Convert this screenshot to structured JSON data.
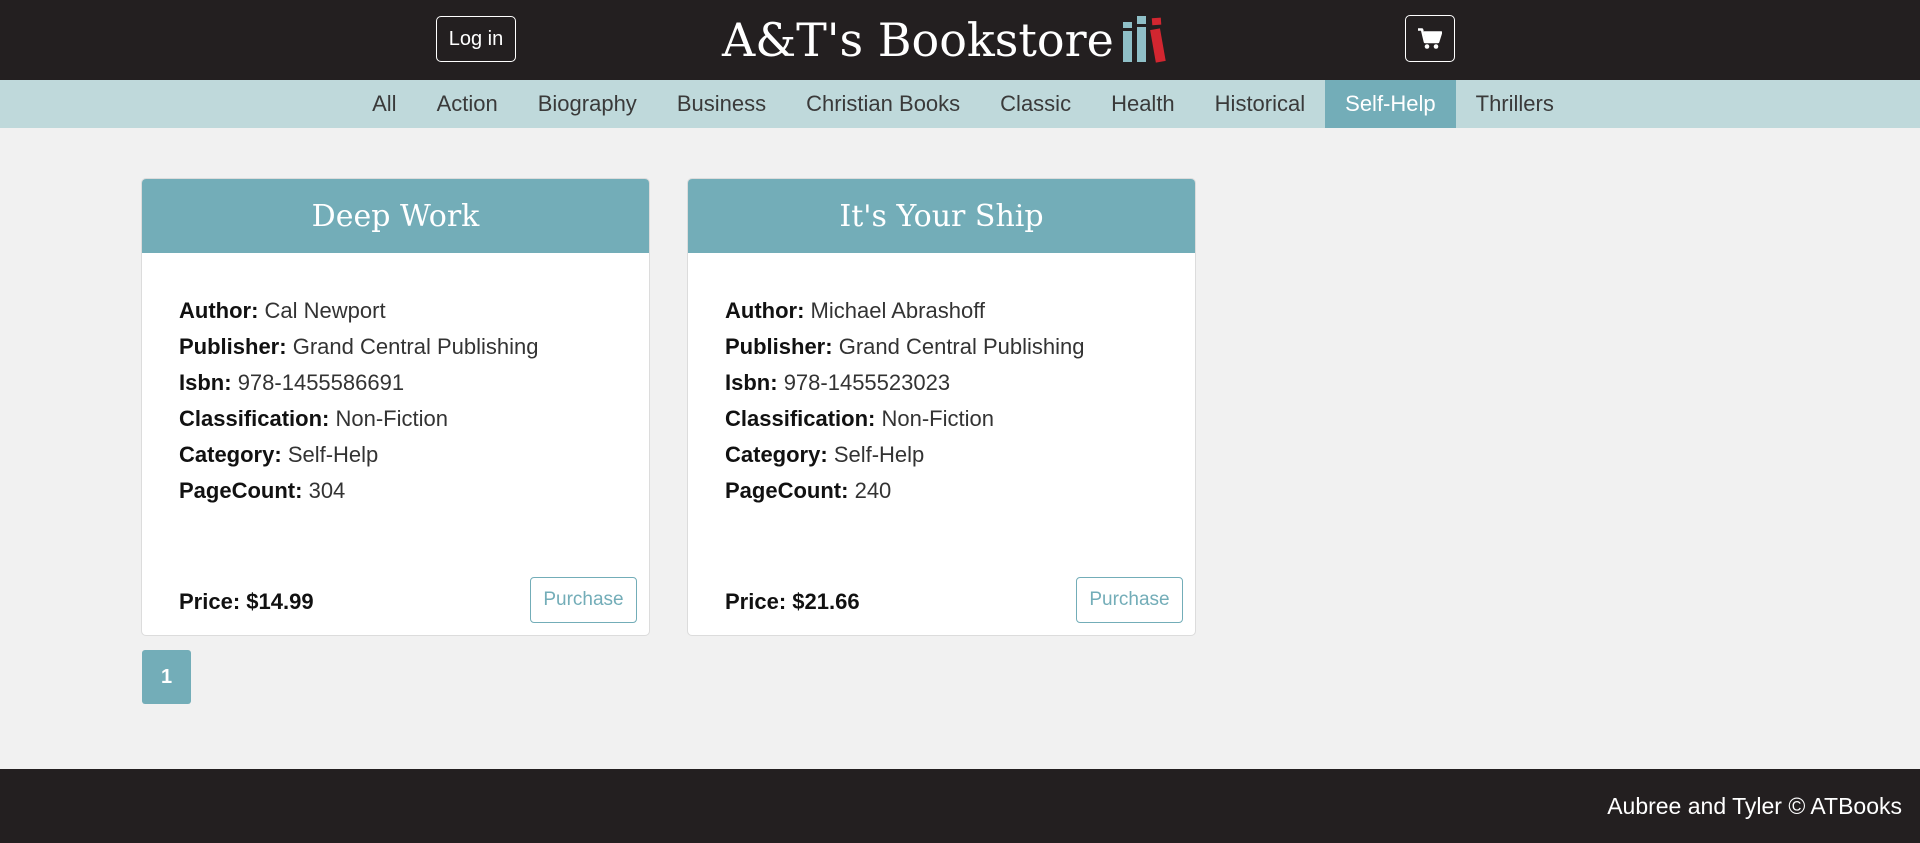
{
  "header": {
    "login_label": "Log in",
    "title": "A&T's Bookstore",
    "logo_icon": "books-icon",
    "cart_icon": "shopping-cart-icon"
  },
  "categories": {
    "items": [
      "All",
      "Action",
      "Biography",
      "Business",
      "Christian Books",
      "Classic",
      "Health",
      "Historical",
      "Self-Help",
      "Thrillers"
    ],
    "active": "Self-Help"
  },
  "labels": {
    "author": "Author:",
    "publisher": "Publisher:",
    "isbn": "Isbn:",
    "classification": "Classification:",
    "category": "Category:",
    "pagecount": "PageCount:",
    "price": "Price:"
  },
  "books": [
    {
      "title": "Deep Work",
      "author": "Cal Newport",
      "publisher": "Grand Central Publishing",
      "isbn": "978-1455586691",
      "classification": "Non-Fiction",
      "category": "Self-Help",
      "pagecount": "304",
      "price": "$14.99",
      "purchase_label": "Purchase"
    },
    {
      "title": "It's Your Ship",
      "author": "Michael Abrashoff",
      "publisher": "Grand Central Publishing",
      "isbn": "978-1455523023",
      "classification": "Non-Fiction",
      "category": "Self-Help",
      "pagecount": "240",
      "price": "$21.66",
      "purchase_label": "Purchase"
    }
  ],
  "pagination": {
    "current": "1"
  },
  "footer": {
    "text": "Aubree and Tyler © ATBooks"
  },
  "colors": {
    "dark": "#231f20",
    "accent": "#73adb8",
    "nav_bg": "#bfd9db",
    "logo_red": "#d22630",
    "logo_teal": "#8fbfc7"
  }
}
